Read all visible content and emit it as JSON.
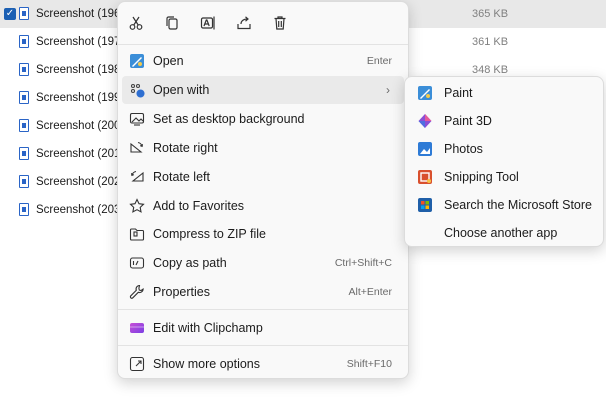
{
  "files": [
    {
      "name": "Screenshot (196)",
      "size": "365 KB",
      "selected": true
    },
    {
      "name": "Screenshot (197)",
      "size": "361 KB",
      "selected": false
    },
    {
      "name": "Screenshot (198)",
      "size": "348 KB",
      "selected": false
    },
    {
      "name": "Screenshot (199)",
      "size": "",
      "selected": false
    },
    {
      "name": "Screenshot (200)",
      "size": "",
      "selected": false
    },
    {
      "name": "Screenshot (201)",
      "size": "",
      "selected": false
    },
    {
      "name": "Screenshot (202)",
      "size": "",
      "selected": false
    },
    {
      "name": "Screenshot (203)",
      "size": "",
      "selected": false
    }
  ],
  "quick_actions": [
    {
      "name": "cut-icon"
    },
    {
      "name": "copy-icon"
    },
    {
      "name": "rename-icon"
    },
    {
      "name": "share-icon"
    },
    {
      "name": "delete-icon"
    }
  ],
  "menu": {
    "items": [
      {
        "label": "Open",
        "shortcut": "Enter",
        "icon": "paint-app-icon"
      },
      {
        "label": "Open with",
        "shortcut": "",
        "icon": "open-with-icon",
        "arrow": "›"
      },
      {
        "label": "Set as desktop background",
        "shortcut": "",
        "icon": "desktop-background-icon"
      },
      {
        "label": "Rotate right",
        "shortcut": "",
        "icon": "rotate-right-icon"
      },
      {
        "label": "Rotate left",
        "shortcut": "",
        "icon": "rotate-left-icon"
      },
      {
        "label": "Add to Favorites",
        "shortcut": "",
        "icon": "star-icon"
      },
      {
        "label": "Compress to ZIP file",
        "shortcut": "",
        "icon": "zip-icon"
      },
      {
        "label": "Copy as path",
        "shortcut": "Ctrl+Shift+C",
        "icon": "copy-path-icon"
      },
      {
        "label": "Properties",
        "shortcut": "Alt+Enter",
        "icon": "wrench-icon"
      },
      {
        "label": "Edit with Clipchamp",
        "shortcut": "",
        "icon": "clipchamp-icon"
      },
      {
        "label": "Show more options",
        "shortcut": "Shift+F10",
        "icon": "more-options-icon"
      }
    ]
  },
  "submenu": {
    "items": [
      {
        "label": "Paint",
        "icon": "paint-icon",
        "color": "#3b8ed8"
      },
      {
        "label": "Paint 3D",
        "icon": "paint-3d-icon",
        "color": "#8a4fd6"
      },
      {
        "label": "Photos",
        "icon": "photos-icon",
        "color": "#2e7bd6"
      },
      {
        "label": "Snipping Tool",
        "icon": "snipping-tool-icon",
        "color": "#d9502e"
      },
      {
        "label": "Search the Microsoft Store",
        "icon": "microsoft-store-icon",
        "color": "#1f5fa8"
      },
      {
        "label": "Choose another app",
        "icon": "",
        "color": ""
      }
    ]
  },
  "colors": {
    "accent": "#1b5fb3",
    "hover": "#eaeaea",
    "menu_bg": "#f9f9f9"
  }
}
